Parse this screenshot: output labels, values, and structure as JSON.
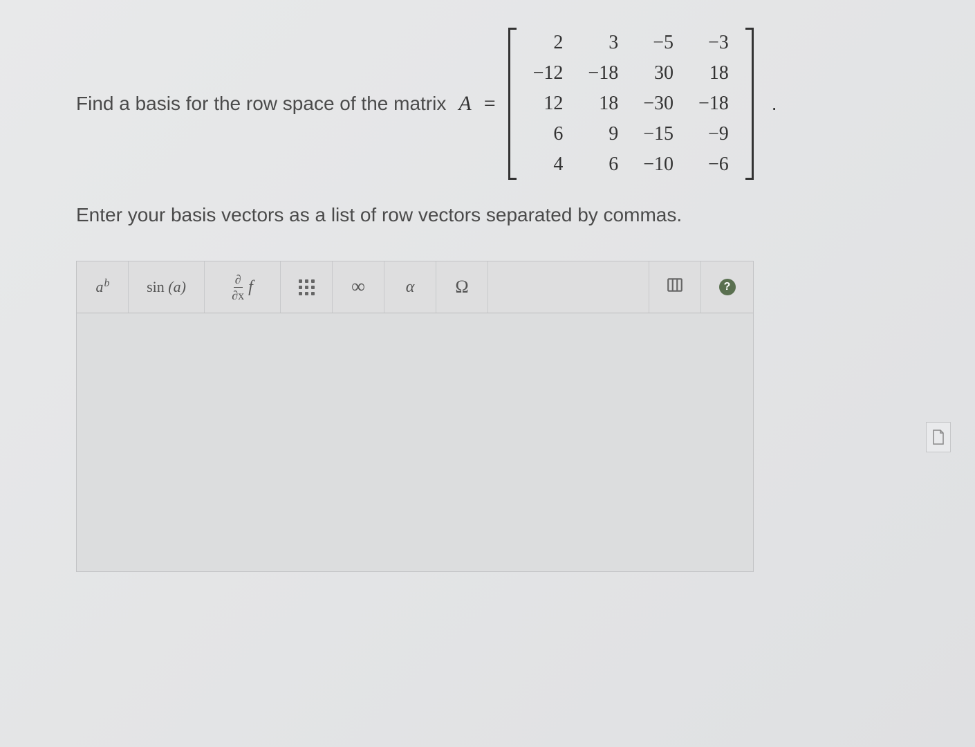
{
  "question": {
    "prompt": "Find a basis for the row space of the matrix",
    "variable": "A",
    "equals": "=",
    "matrix": [
      [
        "2",
        "3",
        "−5",
        "−3"
      ],
      [
        "−12",
        "−18",
        "30",
        "18"
      ],
      [
        "12",
        "18",
        "−30",
        "−18"
      ],
      [
        "6",
        "9",
        "−15",
        "−9"
      ],
      [
        "4",
        "6",
        "−10",
        "−6"
      ]
    ],
    "period": ".",
    "instruction": "Enter your basis vectors as a list of row vectors separated by commas."
  },
  "toolbar": {
    "power": {
      "base": "a",
      "sup": "b"
    },
    "sin": {
      "label": "sin",
      "arg": "(a)"
    },
    "deriv": {
      "num": "∂",
      "den": "∂x",
      "f": "f"
    },
    "infinity": "∞",
    "alpha": "α",
    "omega": "Ω",
    "help": "?"
  }
}
